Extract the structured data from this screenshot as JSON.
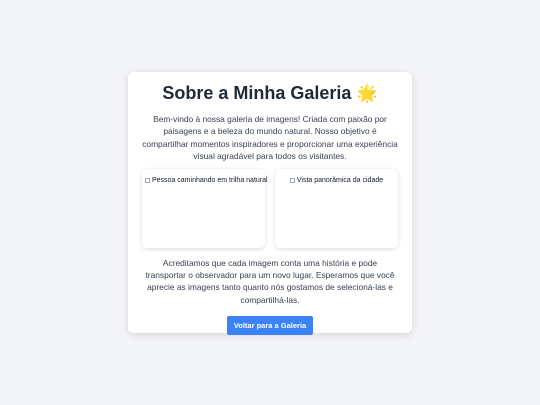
{
  "card": {
    "title": "Sobre a Minha Galeria",
    "title_emoji": "🌟",
    "intro": "Bem-vindo à nossa galeria de imagens! Criada com paixão por paisagens e a beleza do mundo natural. Nosso objetivo é compartilhar momentos inspiradores e proporcionar uma experiência visual agradável para todos os visitantes.",
    "images": [
      {
        "alt": "Pessoa caminhando em trilha natural",
        "icon": "broken-image-icon"
      },
      {
        "alt": "Vista panorâmica da cidade",
        "icon": "broken-image-icon"
      }
    ],
    "outro": "Acreditamos que cada imagem conta uma história e pode transportar o observador para um novo lugar. Esperamos que você aprecie as imagens tanto quanto nós gostamos de selecioná-las e compartilhá-las.",
    "button_label": "Voltar para a Galeria"
  },
  "colors": {
    "background": "#f3f4f6",
    "button": "#3b82f6",
    "title": "#1f2937"
  }
}
